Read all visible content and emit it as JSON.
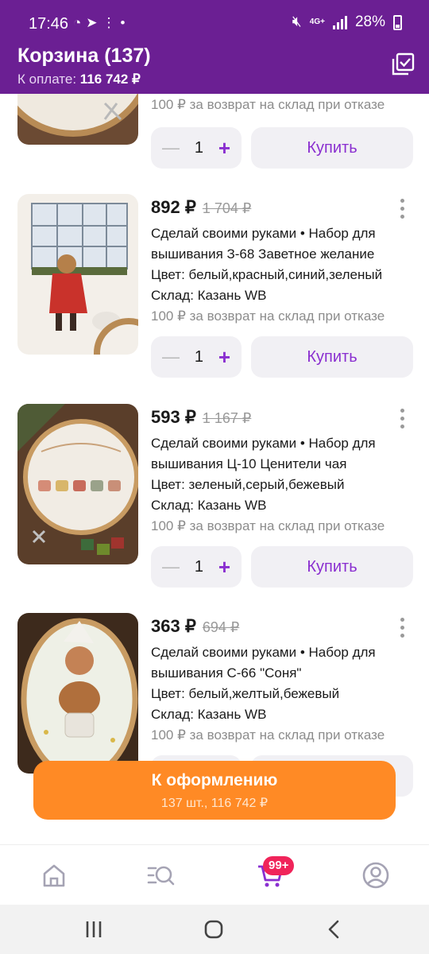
{
  "status_bar": {
    "time": "17:46",
    "network": "4G+",
    "battery": "28%"
  },
  "header": {
    "title": "Корзина (137)",
    "payment_label": "К оплате:",
    "payment_value": "116 742 ₽"
  },
  "items": [
    {
      "return_note": "100 ₽ за возврат на склад при отказе",
      "quantity": "1",
      "buy_label": "Купить"
    },
    {
      "price": "892 ₽",
      "old_price": "1 704 ₽",
      "title_line1": "Сделай своими руками • Набор для",
      "title_line2": "вышивания З-68 Заветное желание",
      "color": "Цвет: белый,красный,синий,зеленый",
      "warehouse": "Склад: Казань WB",
      "return_note": "100 ₽ за возврат на склад при отказе",
      "quantity": "1",
      "buy_label": "Купить"
    },
    {
      "price": "593 ₽",
      "old_price": "1 167 ₽",
      "title_line1": "Сделай своими руками • Набор для",
      "title_line2": "вышивания Ц-10 Ценители чая",
      "color": "Цвет: зеленый,серый,бежевый",
      "warehouse": "Склад: Казань WB",
      "return_note": "100 ₽ за возврат на склад при отказе",
      "quantity": "1",
      "buy_label": "Купить"
    },
    {
      "price": "363 ₽",
      "old_price": "694 ₽",
      "title_line1": "Сделай своими руками • Набор для",
      "title_line2": "вышивания С-66 \"Соня\"",
      "color": "Цвет: белый,желтый,бежевый",
      "warehouse": "Склад: Казань WB",
      "return_note": "100 ₽ за возврат на склад при отказе"
    }
  ],
  "checkout": {
    "label": "К оформлению",
    "summary": "137 шт., 116 742 ₽"
  },
  "bottom_nav": {
    "cart_badge": "99+"
  },
  "colors": {
    "brand": "#6b1f93",
    "accent": "#8a2fd0",
    "checkout": "#ff8a25",
    "badge": "#f0245a"
  }
}
